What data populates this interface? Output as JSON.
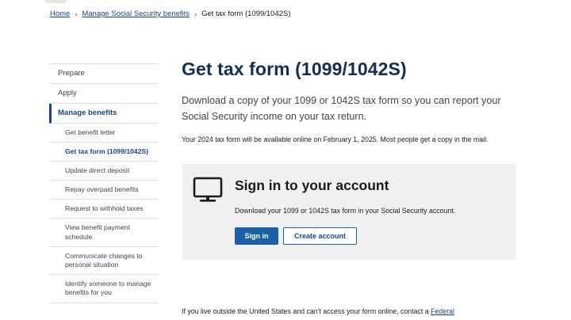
{
  "breadcrumb": {
    "home": "Home",
    "parent": "Manage Social Security benefits",
    "current": "Get tax form (1099/1042S)"
  },
  "sidenav": {
    "prepare": "Prepare",
    "apply": "Apply",
    "manage": "Manage benefits",
    "subitems": [
      "Get benefit letter",
      "Get tax form (1099/1042S)",
      "Update direct deposit",
      "Repay overpaid benefits",
      "Request to withhold taxes",
      "View benefit payment schedule",
      "Communicate changes to personal situation",
      "Identify someone to manage benefits for you"
    ]
  },
  "main": {
    "title": "Get tax form (1099/1042S)",
    "lead": "Download a copy of your 1099 or 1042S tax form so you can report your Social Security income on your tax return.",
    "notice": "Your 2024 tax form will be available online on February 1, 2025. Most people get a copy in the mail."
  },
  "signin_card": {
    "icon": "monitor-icon",
    "title": "Sign in to your account",
    "description": "Download your 1099 or 1042S tax form in your Social Security account.",
    "signin_label": "Sign in",
    "create_label": "Create account"
  },
  "bottom": {
    "text": "If you live outside the United States and can't access your form online, contact a ",
    "link": "Federal"
  },
  "colors": {
    "heading": "#162e51",
    "link": "#1a4480",
    "primary_button": "#1a5fa8",
    "card_bg": "#f0f0f0"
  }
}
